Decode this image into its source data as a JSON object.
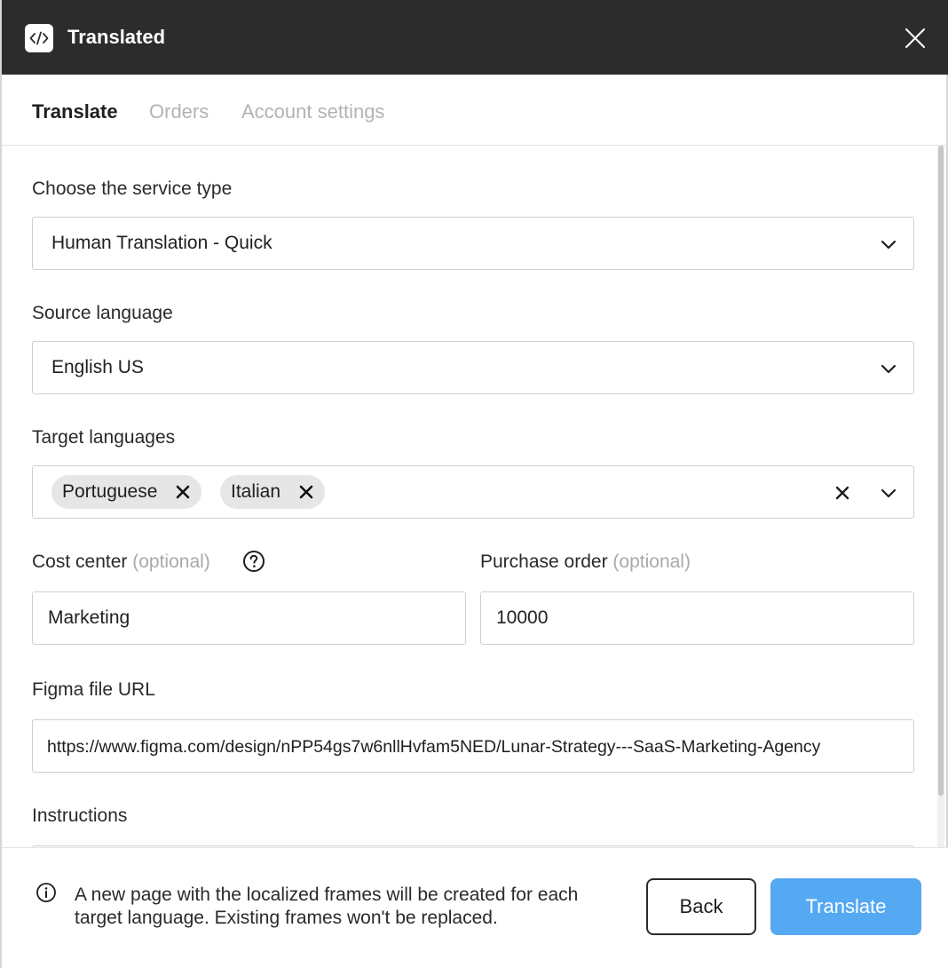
{
  "window": {
    "title": "Translated"
  },
  "tabs": [
    {
      "label": "Translate",
      "active": true
    },
    {
      "label": "Orders",
      "active": false
    },
    {
      "label": "Account settings",
      "active": false
    }
  ],
  "form": {
    "service_type": {
      "label": "Choose the service type",
      "value": "Human Translation - Quick"
    },
    "source_language": {
      "label": "Source language",
      "value": "English US"
    },
    "target_languages": {
      "label": "Target languages",
      "selected": [
        "Portuguese",
        "Italian"
      ]
    },
    "cost_center": {
      "label": "Cost center",
      "optional_text": "(optional)",
      "value": "Marketing"
    },
    "purchase_order": {
      "label": "Purchase order",
      "optional_text": "(optional)",
      "value": "10000"
    },
    "figma_url": {
      "label": "Figma file URL",
      "value": "https://www.figma.com/design/nPP54gs7w6nllHvfam5NED/Lunar-Strategy---SaaS-Marketing-Agency"
    },
    "instructions": {
      "label": "Instructions"
    }
  },
  "footer": {
    "info_text": "A new page with the localized frames will be created for each target language. Existing frames won't be replaced.",
    "back_label": "Back",
    "translate_label": "Translate"
  },
  "colors": {
    "titlebar": "#2c2c2c",
    "primary_button": "#55a8f2",
    "chip_bg": "#e6e6e6",
    "muted_text": "#a9a9a9"
  },
  "icons": [
    "code-icon",
    "close-icon",
    "chevron-down-icon",
    "remove-chip-icon",
    "clear-icon",
    "help-icon",
    "info-icon"
  ]
}
